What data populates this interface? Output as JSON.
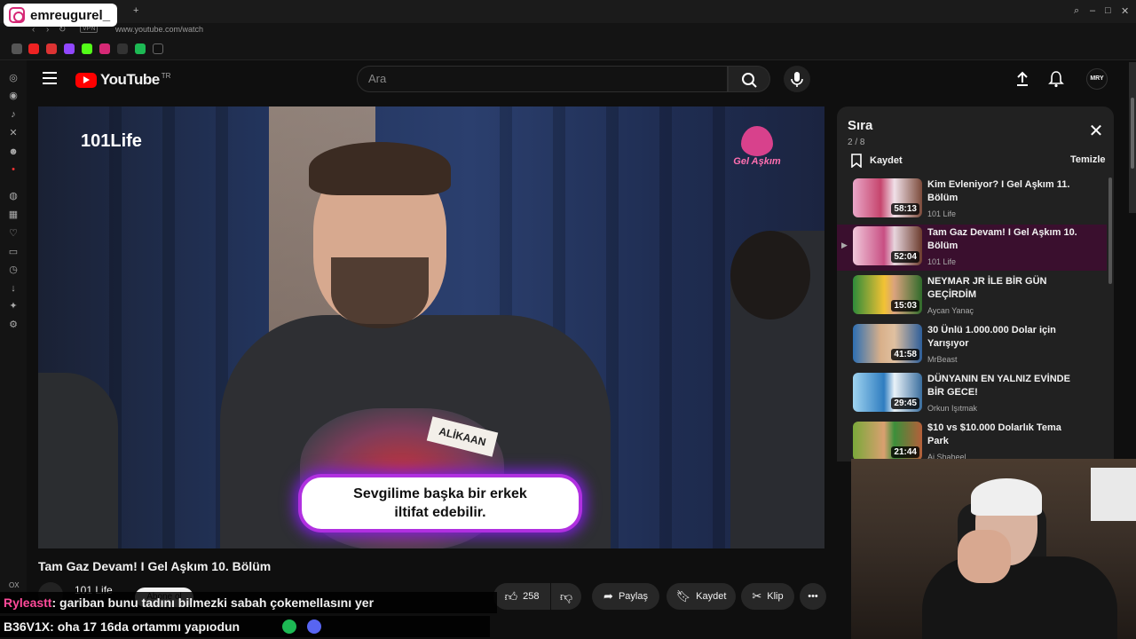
{
  "overlay": {
    "instagram_handle": "emreugurel_"
  },
  "browser": {
    "url": "www.youtube.com/watch",
    "vpn_label": "VPN",
    "side_label": "OX"
  },
  "youtube": {
    "logo_text": "YouTube",
    "country_code": "TR",
    "search_placeholder": "Ara",
    "avatar_text": "MRY",
    "accent": "#ff0000"
  },
  "video": {
    "title": "Tam Gaz Devam! I Gel Aşkım 10. Bölüm",
    "channel": "101 Life",
    "subscribe_label": "Abone ol",
    "likes": "258",
    "share_label": "Paylaş",
    "save_label": "Kaydet",
    "clip_label": "Klip",
    "overlay_logo": "101Life",
    "show_logo": "Gel Aşkım",
    "name_tag": "ALİKAAN",
    "caption_line1": "Sevgilime başka bir erkek",
    "caption_line2": "iltifat edebilir."
  },
  "queue": {
    "title": "Sıra",
    "position": "2 / 8",
    "save_label": "Kaydet",
    "clear_label": "Temizle",
    "items": [
      {
        "title": "Kim Evleniyor? I Gel Aşkım 11. Bölüm",
        "channel": "101 Life",
        "duration": "58:13"
      },
      {
        "title": "Tam Gaz Devam! I Gel Aşkım 10. Bölüm",
        "channel": "101 Life",
        "duration": "52:04",
        "active": true
      },
      {
        "title": "NEYMAR JR İLE BİR GÜN GEÇİRDİM",
        "channel": "Aycan Yanaç",
        "duration": "15:03"
      },
      {
        "title": "30 Ünlü 1.000.000 Dolar için Yarışıyor",
        "channel": "MrBeast",
        "duration": "41:58"
      },
      {
        "title": "DÜNYANIN EN YALNIZ EVİNDE BİR GECE!",
        "channel": "Orkun Işıtmak",
        "duration": "29:45"
      },
      {
        "title": "$10 vs $10.000 Dolarlık Tema Park",
        "channel": "Ai Shaheel",
        "duration": "21:44"
      }
    ]
  },
  "chat": [
    {
      "user": "Ryleastt",
      "message": ": gariban bunu tadını bilmezki sabah çokemellasını yer"
    },
    {
      "user": "B36V1X",
      "message": ": oha 17 16da ortammı yapıodun"
    }
  ]
}
